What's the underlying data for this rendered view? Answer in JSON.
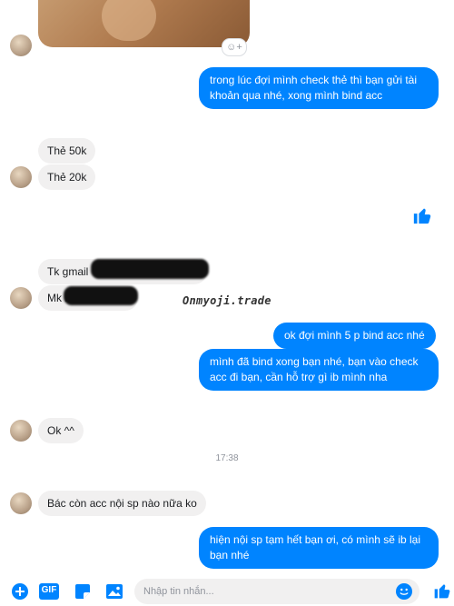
{
  "conversation": {
    "messages": [
      {
        "side": "out",
        "text": "trong lúc đợi mình check thẻ thì bạn gửi tài khoản qua nhé, xong mình bind acc"
      },
      {
        "side": "in",
        "text": "Thẻ 50k"
      },
      {
        "side": "in",
        "text": "Thẻ 20k"
      },
      {
        "side": "in",
        "text": "Tk gmail"
      },
      {
        "side": "in",
        "text": "Mk h"
      },
      {
        "side": "out",
        "text": "ok đợi mình 5 p bind acc nhé"
      },
      {
        "side": "out",
        "text": "mình đã bind xong bạn nhé, bạn vào check acc đi bạn, cần hỗ trợ gì ib mình nha"
      },
      {
        "side": "in",
        "text": "Ok ^^"
      },
      {
        "side": "in",
        "text": "Bác còn acc nội sp nào nữa ko"
      },
      {
        "side": "out",
        "text": "hiện nội sp tạm hết bạn ơi, có mình sẽ ib lại bạn nhé"
      }
    ],
    "timestamp": "17:38",
    "watermark": "Onmyoji.trade"
  },
  "composer": {
    "placeholder": "Nhập tin nhắn...",
    "gif_label": "GIF"
  },
  "icons": {
    "add": "plus-circle-icon",
    "gif": "gif-icon",
    "sticker": "sticker-icon",
    "image": "image-icon",
    "emoji": "emoji-icon",
    "like": "thumbs-up-icon",
    "reaction": "add-reaction-icon"
  },
  "colors": {
    "accent": "#0084ff",
    "incoming_bubble": "#f1f0f0",
    "text": "#1c1e21",
    "muted": "#90949c"
  }
}
